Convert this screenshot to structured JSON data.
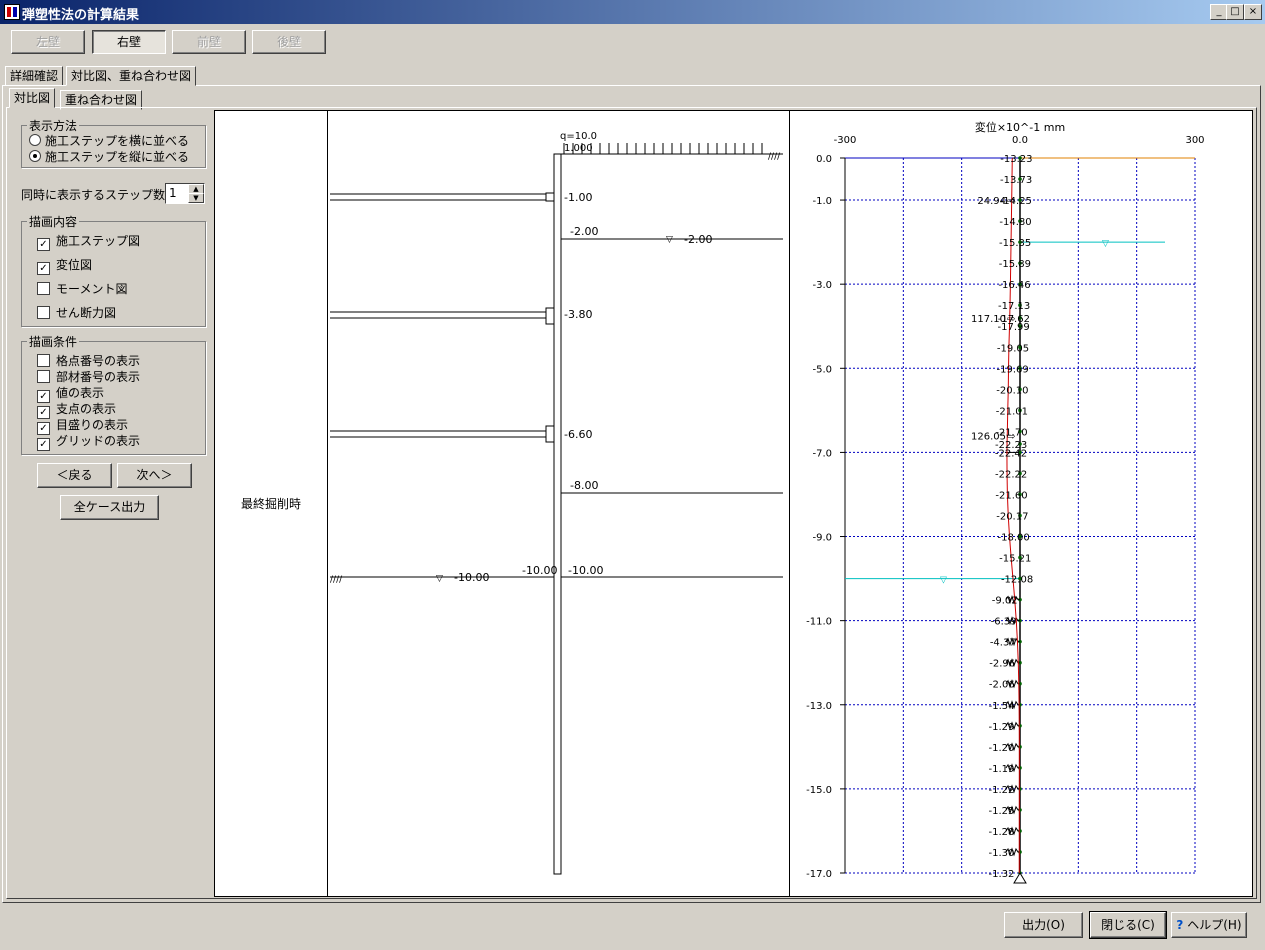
{
  "window": {
    "title": "弾塑性法の計算結果",
    "minimize": "_",
    "maximize": "□",
    "close": "×"
  },
  "wall_buttons": [
    "左壁",
    "右壁",
    "前壁",
    "後壁"
  ],
  "tabs_top": [
    "詳細確認",
    "対比図、重ね合わせ図"
  ],
  "tabs_sub": [
    "対比図",
    "重ね合わせ図"
  ],
  "display_method": {
    "title": "表示方法",
    "options": [
      "施工ステップを横に並べる",
      "施工ステップを縦に並べる"
    ],
    "selected": 1
  },
  "step_count": {
    "label": "同時に表示するステップ数",
    "value": "1"
  },
  "draw_content": {
    "title": "描画内容",
    "items": [
      {
        "label": "施工ステップ図",
        "checked": true
      },
      {
        "label": "変位図",
        "checked": true
      },
      {
        "label": "モーメント図",
        "checked": false
      },
      {
        "label": "せん断力図",
        "checked": false
      }
    ]
  },
  "draw_conditions": {
    "title": "描画条件",
    "items": [
      {
        "label": "格点番号の表示",
        "checked": false
      },
      {
        "label": "部材番号の表示",
        "checked": false
      },
      {
        "label": "値の表示",
        "checked": true
      },
      {
        "label": "支点の表示",
        "checked": true
      },
      {
        "label": "目盛りの表示",
        "checked": true
      },
      {
        "label": "グリッドの表示",
        "checked": true
      }
    ]
  },
  "nav": {
    "prev": "＜戻る",
    "next": "次へ＞",
    "output_all": "全ケース出力"
  },
  "step_label": "最終掘削時",
  "step_diagram": {
    "load_label": "q=10.0",
    "load_value": "1.000",
    "strut_labels": [
      "-1.00",
      "-3.80",
      "-6.60"
    ],
    "level_labels": [
      "-2.00",
      "-8.00",
      "-10.00"
    ],
    "water_label_upper": "-2.00",
    "water_label_lower": "-10.00",
    "excavation_label": "-10.00"
  },
  "chart_data": {
    "type": "line",
    "title": "変位×10^-1 mm",
    "x_ticks": [
      "-300",
      "0.0",
      "300"
    ],
    "xlim": [
      -300,
      300
    ],
    "ylim": [
      0,
      -17
    ],
    "y_ticks": [
      "0.0",
      "-1.0",
      "-3.0",
      "-5.0",
      "-7.0",
      "-9.0",
      "-11.0",
      "-13.0",
      "-15.0",
      "-17.0"
    ],
    "grid": true,
    "series": [
      {
        "depth": [
          0,
          -0.5,
          -1,
          -1.5,
          -2,
          -2.5,
          -3,
          -3.5,
          -3.8,
          -4,
          -4.5,
          -5,
          -5.5,
          -6,
          -6.5,
          -6.8,
          -7,
          -7.5,
          -8,
          -8.5,
          -9,
          -9.5,
          -10,
          -10.5,
          -11,
          -11.5,
          -12,
          -12.5,
          -13,
          -13.5,
          -14,
          -14.5,
          -15,
          -15.5,
          -16,
          -16.5,
          -17
        ],
        "displacement": [
          -13.23,
          -13.73,
          -14.25,
          -14.8,
          -15.35,
          -15.89,
          -16.46,
          -17.13,
          -17.62,
          -17.99,
          -19.05,
          -19.69,
          -20.1,
          -21.01,
          -21.7,
          -22.23,
          -22.42,
          -22.22,
          -21.6,
          -20.17,
          -18.0,
          -15.21,
          -12.08,
          -9.02,
          -6.39,
          -4.37,
          -2.96,
          -2.06,
          -1.54,
          -1.29,
          -1.2,
          -1.19,
          -1.22,
          -1.25,
          -1.28,
          -1.3,
          -1.32
        ]
      }
    ],
    "value_labels": [
      "-13.23",
      "-13.73",
      "-14.25",
      "-14.80",
      "-15.35",
      "-15.89",
      "-16.46",
      "-17.13",
      "-17.62",
      "-17.99",
      "-19.05",
      "-19.69",
      "-20.10",
      "-21.01",
      "-21.70",
      "-22.23",
      "-22.42",
      "-22.22",
      "-21.60",
      "-20.17",
      "-18.00",
      "-15.21",
      "-12.08",
      "-9.02",
      "-6.39",
      "-4.37",
      "-2.96",
      "-2.06",
      "-1.54",
      "-1.29",
      "-1.20",
      "-1.19",
      "-1.22",
      "-1.25",
      "-1.28",
      "-1.30",
      "-1.32"
    ],
    "strut_forces": [
      {
        "depth": -1.0,
        "value": "24.94"
      },
      {
        "depth": -3.8,
        "value": "117.10"
      },
      {
        "depth": -6.6,
        "value": "126.05"
      }
    ],
    "water_levels": [
      -2.0,
      -10.0
    ],
    "excavation_depth": -7.0
  },
  "bottom_buttons": {
    "output": "出力(O)",
    "close": "閉じる(C)",
    "help": "ヘルプ(H)"
  },
  "colors": {
    "displacement_line": "#d00000",
    "water": "#00c0c0",
    "grid": "#0000c0",
    "titlebar": "#0a246a"
  }
}
